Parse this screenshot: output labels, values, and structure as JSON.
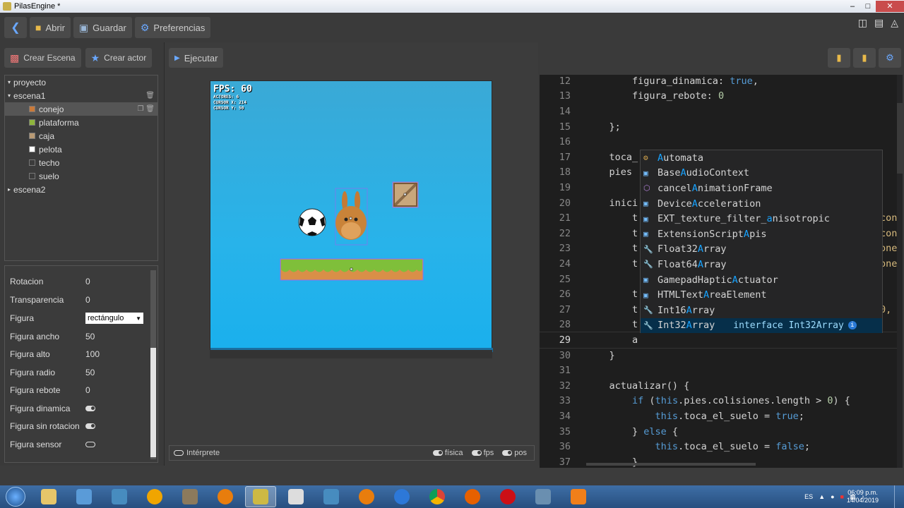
{
  "window": {
    "title": "PilasEngine *"
  },
  "toolbar": {
    "open_label": "Abrir",
    "save_label": "Guardar",
    "prefs_label": "Preferencias"
  },
  "left": {
    "create_scene_label": "Crear Escena",
    "create_actor_label": "Crear actor",
    "tree": [
      {
        "label": "proyecto",
        "level": 0
      },
      {
        "label": "escena1",
        "level": 0
      },
      {
        "label": "conejo",
        "level": 1
      },
      {
        "label": "plataforma",
        "level": 1
      },
      {
        "label": "caja",
        "level": 1
      },
      {
        "label": "pelota",
        "level": 1
      },
      {
        "label": "techo",
        "level": 1
      },
      {
        "label": "suelo",
        "level": 1
      },
      {
        "label": "escena2",
        "level": 0
      }
    ],
    "properties": [
      {
        "label": "Rotacion",
        "value": "0"
      },
      {
        "label": "Transparencia",
        "value": "0"
      },
      {
        "label": "Figura",
        "value": "rectángulo"
      },
      {
        "label": "Figura ancho",
        "value": "50"
      },
      {
        "label": "Figura alto",
        "value": "100"
      },
      {
        "label": "Figura radio",
        "value": "50"
      },
      {
        "label": "Figura rebote",
        "value": "0"
      },
      {
        "label": "Figura dinamica",
        "value": ""
      },
      {
        "label": "Figura sin rotacion",
        "value": ""
      },
      {
        "label": "Figura sensor",
        "value": ""
      }
    ]
  },
  "center": {
    "run_label": "Ejecutar",
    "fps_label": "FPS: 60",
    "actors_label": "ACTORES: 6",
    "cursor_x_label": "CURSOR X: 214",
    "cursor_y_label": "CURSOR Y: 50",
    "interpreter_label": "Intérprete",
    "physics_label": "física",
    "fps_toggle_label": "fps",
    "pos_label": "pos"
  },
  "editor": {
    "lines": [
      {
        "n": "12",
        "text": "        figura_dinamica: true,"
      },
      {
        "n": "13",
        "text": "        figura_rebote: 0"
      },
      {
        "n": "14",
        "text": ""
      },
      {
        "n": "15",
        "text": "    };"
      },
      {
        "n": "16",
        "text": ""
      },
      {
        "n": "17",
        "text": "    toca_"
      },
      {
        "n": "18",
        "text": "    pies "
      },
      {
        "n": "19",
        "text": ""
      },
      {
        "n": "20",
        "text": "    inici"
      },
      {
        "n": "21",
        "text": "        t"
      },
      {
        "n": "22",
        "text": "        t"
      },
      {
        "n": "23",
        "text": "        t"
      },
      {
        "n": "24",
        "text": "        t"
      },
      {
        "n": "25",
        "text": ""
      },
      {
        "n": "26",
        "text": "        t"
      },
      {
        "n": "27",
        "text": "        t"
      },
      {
        "n": "28",
        "text": "        t"
      },
      {
        "n": "29",
        "text": "        a"
      },
      {
        "n": "30",
        "text": "    }"
      },
      {
        "n": "31",
        "text": ""
      },
      {
        "n": "32",
        "text": "    actualizar() {"
      },
      {
        "n": "33",
        "text": "        if (this.pies.colisiones.length > 0) {"
      },
      {
        "n": "34",
        "text": "            this.toca_el_suelo = true;"
      },
      {
        "n": "35",
        "text": "        } else {"
      },
      {
        "n": "36",
        "text": "            this.toca_el_suelo = false;"
      },
      {
        "n": "37",
        "text": "        }"
      }
    ],
    "right_overflow": {
      "21": "cone",
      "22": "cone",
      "23": "onej",
      "24": "onej",
      "27": "0, "
    },
    "autocomplete": [
      {
        "pre": "",
        "hl": "A",
        "post": "utomata",
        "icon": "gear-icon"
      },
      {
        "pre": "Base",
        "hl": "A",
        "post": "udioContext",
        "icon": "interface-icon"
      },
      {
        "pre": "cancel",
        "hl": "A",
        "post": "nimationFrame",
        "icon": "cube-icon"
      },
      {
        "pre": "Device",
        "hl": "A",
        "post": "cceleration",
        "icon": "interface-icon"
      },
      {
        "pre": "EXT_texture_filter_",
        "hl": "a",
        "post": "nisotropic",
        "icon": "interface-icon"
      },
      {
        "pre": "ExtensionScript",
        "hl": "A",
        "post": "pis",
        "icon": "interface-icon"
      },
      {
        "pre": "Float32",
        "hl": "A",
        "post": "rray",
        "icon": "wrench-icon"
      },
      {
        "pre": "Float64",
        "hl": "A",
        "post": "rray",
        "icon": "wrench-icon"
      },
      {
        "pre": "GamepadHaptic",
        "hl": "A",
        "post": "ctuator",
        "icon": "interface-icon"
      },
      {
        "pre": "HTMLText",
        "hl": "A",
        "post": "reaElement",
        "icon": "interface-icon"
      },
      {
        "pre": "Int16",
        "hl": "A",
        "post": "rray",
        "icon": "wrench-icon"
      },
      {
        "pre": "Int32",
        "hl": "A",
        "post": "rray",
        "icon": "wrench-icon"
      }
    ],
    "selected_detail": "interface Int32Array"
  },
  "taskbar": {
    "lang": "ES",
    "time": "06:09 p.m.",
    "date": "14/04/2019"
  },
  "colors": {
    "accent_blue": "#569cd6",
    "highlight": "#18a3ff",
    "autocomplete_selected": "#062f4a"
  }
}
